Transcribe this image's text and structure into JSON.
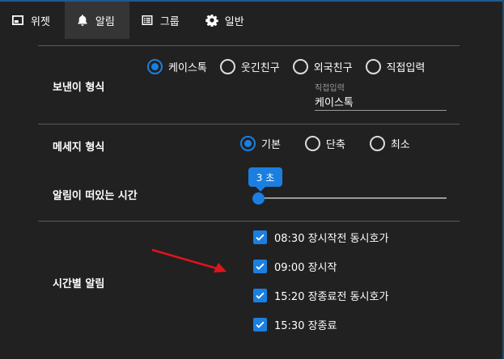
{
  "tabs": [
    {
      "label": "위젯",
      "icon": "widget-icon"
    },
    {
      "label": "알림",
      "icon": "bell-icon",
      "active": true
    },
    {
      "label": "그룹",
      "icon": "list-icon"
    },
    {
      "label": "일반",
      "icon": "gear-icon"
    }
  ],
  "sender": {
    "label": "보낸이 형식",
    "options": [
      "케이스톡",
      "웃긴친구",
      "외국친구",
      "직접입력"
    ],
    "selected": "케이스톡",
    "custom_field": {
      "label": "직접입력",
      "value": "케이스톡"
    }
  },
  "message": {
    "label": "메세지 형식",
    "options": [
      "기본",
      "단축",
      "최소"
    ],
    "selected": "기본"
  },
  "duration": {
    "label": "알림이 떠있는 시간",
    "value_label": "3 초",
    "value_seconds": 3
  },
  "schedule": {
    "label": "시간별 알림",
    "items": [
      {
        "label": "08:30 장시작전 동시호가",
        "checked": true
      },
      {
        "label": "09:00 장시작",
        "checked": true
      },
      {
        "label": "15:20 장종료전 동시호가",
        "checked": true
      },
      {
        "label": "15:30 장종료",
        "checked": true
      }
    ]
  },
  "colors": {
    "background": "#212121",
    "accent": "#1a7fe0",
    "active_tab": "#353535",
    "annotation_arrow": "#e0141e"
  }
}
